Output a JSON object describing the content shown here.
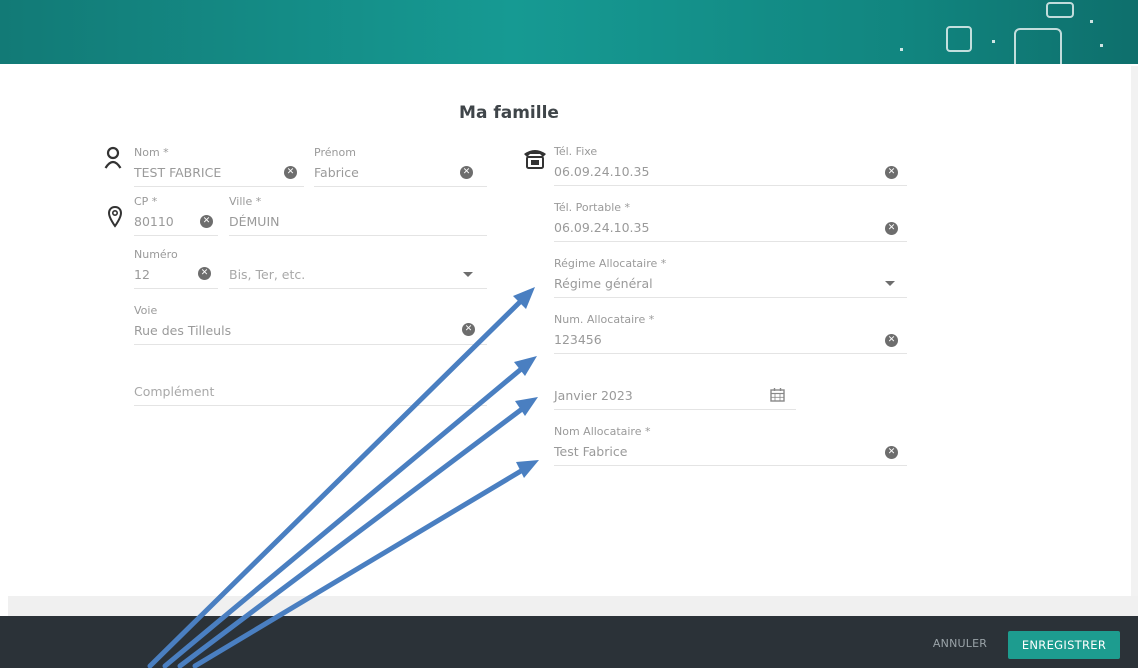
{
  "page": {
    "title": "Ma famille"
  },
  "identity": {
    "nom": {
      "label": "Nom *",
      "value": "TEST FABRICE"
    },
    "prenom": {
      "label": "Prénom",
      "value": "Fabrice"
    }
  },
  "address": {
    "cp": {
      "label": "CP *",
      "value": "80110"
    },
    "ville": {
      "label": "Ville *",
      "value": "DÉMUIN"
    },
    "numero": {
      "label": "Numéro",
      "value": "12"
    },
    "suffix": {
      "placeholder": "Bis, Ter, etc."
    },
    "voie": {
      "label": "Voie",
      "value": "Rue des Tilleuls"
    },
    "complement": {
      "placeholder": "Complément"
    }
  },
  "contact": {
    "tel_fixe": {
      "label": "Tél. Fixe",
      "value": "06.09.24.10.35"
    },
    "tel_portable": {
      "label": "Tél. Portable *",
      "value": "06.09.24.10.35"
    },
    "regime": {
      "label": "Régime Allocataire *",
      "value": "Régime général"
    },
    "num_allocataire": {
      "label": "Num. Allocataire *",
      "value": "123456"
    },
    "date": {
      "value": "Janvier 2023"
    },
    "nom_allocataire": {
      "label": "Nom Allocataire *",
      "value": "Test Fabrice"
    }
  },
  "footer": {
    "cancel_label": "ANNULER",
    "save_label": "ENREGISTRER"
  },
  "icons": {
    "identity": "person-icon",
    "address": "location-pin-icon",
    "phone": "telephone-icon",
    "clear": "clear-circle-icon",
    "dropdown": "caret-down-icon",
    "calendar": "calendar-icon"
  },
  "colors": {
    "banner": "#169a93",
    "footer": "#2b3238",
    "save_button": "#1d9c8f",
    "annotation_arrows": "#4a7fc1"
  }
}
